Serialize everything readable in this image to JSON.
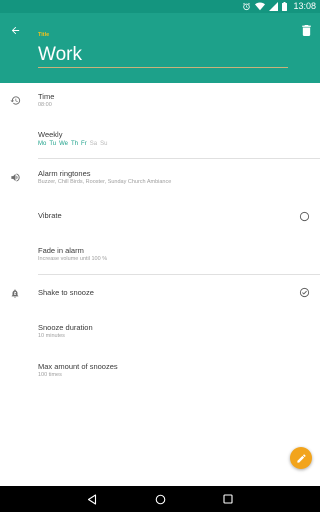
{
  "status_bar": {
    "time": "13:08",
    "icons": [
      "alarm-icon",
      "wifi-icon",
      "signal-icon",
      "battery-icon"
    ]
  },
  "app_bar": {
    "title_label": "Title",
    "title_value": "Work",
    "back_icon": "arrow-back-icon",
    "delete_icon": "trash-icon"
  },
  "settings": {
    "time": {
      "label": "Time",
      "value": "08:00",
      "icon": "history-icon"
    },
    "weekly": {
      "label": "Weekly",
      "days": [
        {
          "label": "Mo",
          "active": true
        },
        {
          "label": "Tu",
          "active": true
        },
        {
          "label": "We",
          "active": true
        },
        {
          "label": "Th",
          "active": true
        },
        {
          "label": "Fr",
          "active": true
        },
        {
          "label": "Sa",
          "active": false
        },
        {
          "label": "Su",
          "active": false
        }
      ]
    },
    "ringtones": {
      "label": "Alarm ringtones",
      "value": "Buzzer, Chill Birds, Rooster, Sunday Church Ambiance",
      "icon": "volume-icon"
    },
    "vibrate": {
      "label": "Vibrate",
      "checked": false
    },
    "fade": {
      "label": "Fade in alarm",
      "value": "Increase volume until 100 %"
    },
    "shake": {
      "label": "Shake to snooze",
      "checked": true,
      "icon": "snooze-bell-icon"
    },
    "snooze_duration": {
      "label": "Snooze duration",
      "value": "10 minutes"
    },
    "max_snoozes": {
      "label": "Max amount of snoozes",
      "value": "100 times"
    }
  },
  "fab": {
    "icon": "edit-pencil-icon"
  },
  "nav_bar": {
    "icons": [
      "nav-back-icon",
      "nav-home-icon",
      "nav-recents-icon"
    ]
  },
  "colors": {
    "primary": "#1da18a",
    "primary_dark": "#14957f",
    "accent": "#f2a41c",
    "title_label": "#f3c21b"
  }
}
